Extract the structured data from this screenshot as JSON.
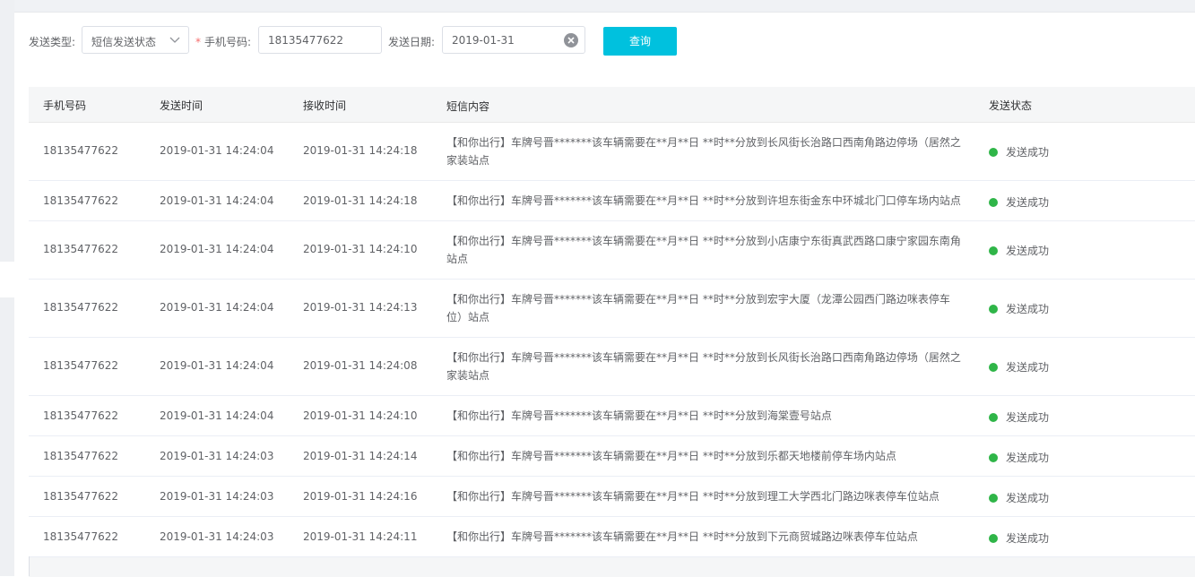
{
  "filters": {
    "send_type_label": "发送类型:",
    "send_type_value": "短信发送状态",
    "phone_label": "手机号码:",
    "phone_value": "18135477622",
    "date_label": "发送日期:",
    "date_value": "2019-01-31",
    "query_button": "查询"
  },
  "table": {
    "columns": [
      "手机号码",
      "发送时间",
      "接收时间",
      "短信内容",
      "发送状态"
    ],
    "rows": [
      {
        "phone": "18135477622",
        "send_time": "2019-01-31 14:24:04",
        "recv_time": "2019-01-31 14:24:18",
        "content": "【和你出行】车牌号晋*******该车辆需要在**月**日 **时**分放到长风街长治路口西南角路边停场（居然之家装站点",
        "status": "发送成功",
        "tall": true
      },
      {
        "phone": "18135477622",
        "send_time": "2019-01-31 14:24:04",
        "recv_time": "2019-01-31 14:24:18",
        "content": "【和你出行】车牌号晋*******该车辆需要在**月**日 **时**分放到许坦东街金东中环城北门口停车场内站点",
        "status": "发送成功",
        "tall": false
      },
      {
        "phone": "18135477622",
        "send_time": "2019-01-31 14:24:04",
        "recv_time": "2019-01-31 14:24:10",
        "content": "【和你出行】车牌号晋*******该车辆需要在**月**日 **时**分放到小店康宁东街真武西路口康宁家园东南角站点",
        "status": "发送成功",
        "tall": true
      },
      {
        "phone": "18135477622",
        "send_time": "2019-01-31 14:24:04",
        "recv_time": "2019-01-31 14:24:13",
        "content": "【和你出行】车牌号晋*******该车辆需要在**月**日 **时**分放到宏宇大厦（龙潭公园西门路边咪表停车位）站点",
        "status": "发送成功",
        "tall": true
      },
      {
        "phone": "18135477622",
        "send_time": "2019-01-31 14:24:04",
        "recv_time": "2019-01-31 14:24:08",
        "content": "【和你出行】车牌号晋*******该车辆需要在**月**日 **时**分放到长风街长治路口西南角路边停场（居然之家装站点",
        "status": "发送成功",
        "tall": true
      },
      {
        "phone": "18135477622",
        "send_time": "2019-01-31 14:24:04",
        "recv_time": "2019-01-31 14:24:10",
        "content": "【和你出行】车牌号晋*******该车辆需要在**月**日 **时**分放到海棠壹号站点",
        "status": "发送成功",
        "tall": false
      },
      {
        "phone": "18135477622",
        "send_time": "2019-01-31 14:24:03",
        "recv_time": "2019-01-31 14:24:14",
        "content": "【和你出行】车牌号晋*******该车辆需要在**月**日 **时**分放到乐都天地楼前停车场内站点",
        "status": "发送成功",
        "tall": false
      },
      {
        "phone": "18135477622",
        "send_time": "2019-01-31 14:24:03",
        "recv_time": "2019-01-31 14:24:16",
        "content": "【和你出行】车牌号晋*******该车辆需要在**月**日 **时**分放到理工大学西北门路边咪表停车位站点",
        "status": "发送成功",
        "tall": false
      },
      {
        "phone": "18135477622",
        "send_time": "2019-01-31 14:24:03",
        "recv_time": "2019-01-31 14:24:11",
        "content": "【和你出行】车牌号晋*******该车辆需要在**月**日 **时**分放到下元商贸城路边咪表停车位站点",
        "status": "发送成功",
        "tall": false
      }
    ]
  },
  "colors": {
    "accent": "#00c1de",
    "success": "#2fb548",
    "required": "#f56c6c"
  },
  "icons": {
    "select_arrow": "chevron-down-icon",
    "date_clear": "clear-circle-icon",
    "status": "status-dot-icon"
  }
}
